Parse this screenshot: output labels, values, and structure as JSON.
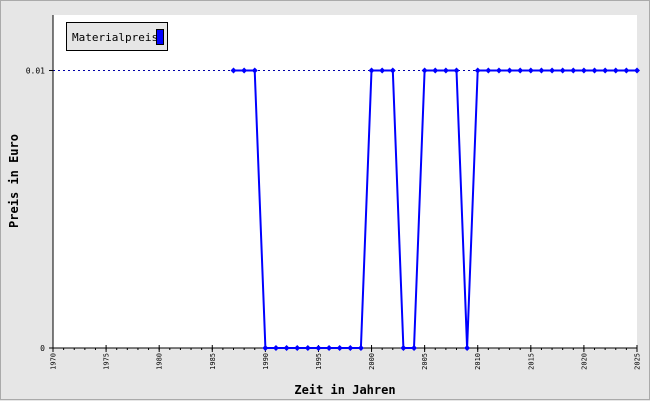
{
  "chart_data": {
    "type": "line",
    "xlabel": "Zeit in Jahren",
    "ylabel": "Preis in Euro",
    "xlim": [
      1970,
      2025
    ],
    "ylim": [
      0,
      0.012
    ],
    "x_ticks": [
      1970,
      1975,
      1980,
      1985,
      1990,
      1995,
      2000,
      2005,
      2010,
      2015,
      2020,
      2025
    ],
    "y_ticks": [
      {
        "value": 0,
        "label": "0"
      },
      {
        "value": 0.01,
        "label": "0.01"
      }
    ],
    "reference_lines": [
      {
        "y": 0.01,
        "style": "dotted"
      }
    ],
    "grid": false,
    "legend_position": "top-left",
    "colors": {
      "series": "#0000ff",
      "reference": "#0000aa",
      "background": "#e6e6e6",
      "plot": "#ffffff"
    },
    "series": [
      {
        "name": "Materialpreis",
        "x": [
          1987,
          1988,
          1989,
          1990,
          1991,
          1992,
          1993,
          1994,
          1995,
          1996,
          1997,
          1998,
          1999,
          2000,
          2001,
          2002,
          2003,
          2004,
          2005,
          2006,
          2007,
          2008,
          2009,
          2010,
          2011,
          2012,
          2013,
          2014,
          2015,
          2016,
          2017,
          2018,
          2019,
          2020,
          2021,
          2022,
          2023,
          2024,
          2025
        ],
        "values": [
          0.01,
          0.01,
          0.01,
          0,
          0,
          0,
          0,
          0,
          0,
          0,
          0,
          0,
          0,
          0.01,
          0.01,
          0.01,
          0,
          0,
          0.01,
          0.01,
          0.01,
          0.01,
          0,
          0.01,
          0.01,
          0.01,
          0.01,
          0.01,
          0.01,
          0.01,
          0.01,
          0.01,
          0.01,
          0.01,
          0.01,
          0.01,
          0.01,
          0.01,
          0.01
        ]
      }
    ]
  }
}
